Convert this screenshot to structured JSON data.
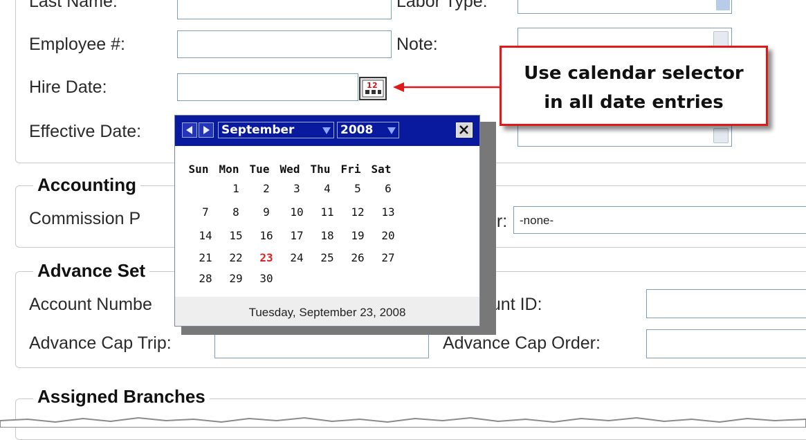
{
  "form": {
    "last_name_label": "Last Name:",
    "labor_type_label": "Labor Type:",
    "employee_label": "Employee #:",
    "note_label": "Note:",
    "hire_date_label": "Hire Date:",
    "effective_date_label": "Effective Date:"
  },
  "accounting": {
    "legend": "Accounting",
    "commission_label": "Commission P",
    "vendor_label_fragment": "or:",
    "vendor_value": "-none-"
  },
  "advance": {
    "legend": "Advance Set",
    "account_number_label": "Account Numbe",
    "account_id_label": "ount ID:",
    "cap_trip_label": "Advance Cap Trip:",
    "cap_order_label": "Advance Cap Order:"
  },
  "branches": {
    "legend": "Assigned Branches"
  },
  "calendar": {
    "month": "September",
    "year": "2008",
    "weekdays": [
      "Sun",
      "Mon",
      "Tue",
      "Wed",
      "Thu",
      "Fri",
      "Sat"
    ],
    "weeks": [
      [
        "",
        "1",
        "2",
        "3",
        "4",
        "5",
        "6"
      ],
      [
        "7",
        "8",
        "9",
        "10",
        "11",
        "12",
        "13"
      ],
      [
        "14",
        "15",
        "16",
        "17",
        "18",
        "19",
        "20"
      ],
      [
        "21",
        "22",
        "23",
        "24",
        "25",
        "26",
        "27"
      ],
      [
        "28",
        "29",
        "30",
        "",
        "",
        "",
        ""
      ]
    ],
    "selected_day": "23",
    "footer": "Tuesday, September 23, 2008",
    "colors": {
      "header": "#0a1a9e",
      "today": "#e02020"
    }
  },
  "callout": {
    "line1": "Use calendar selector",
    "line2": "in all date entries",
    "border_color": "#e01818"
  }
}
